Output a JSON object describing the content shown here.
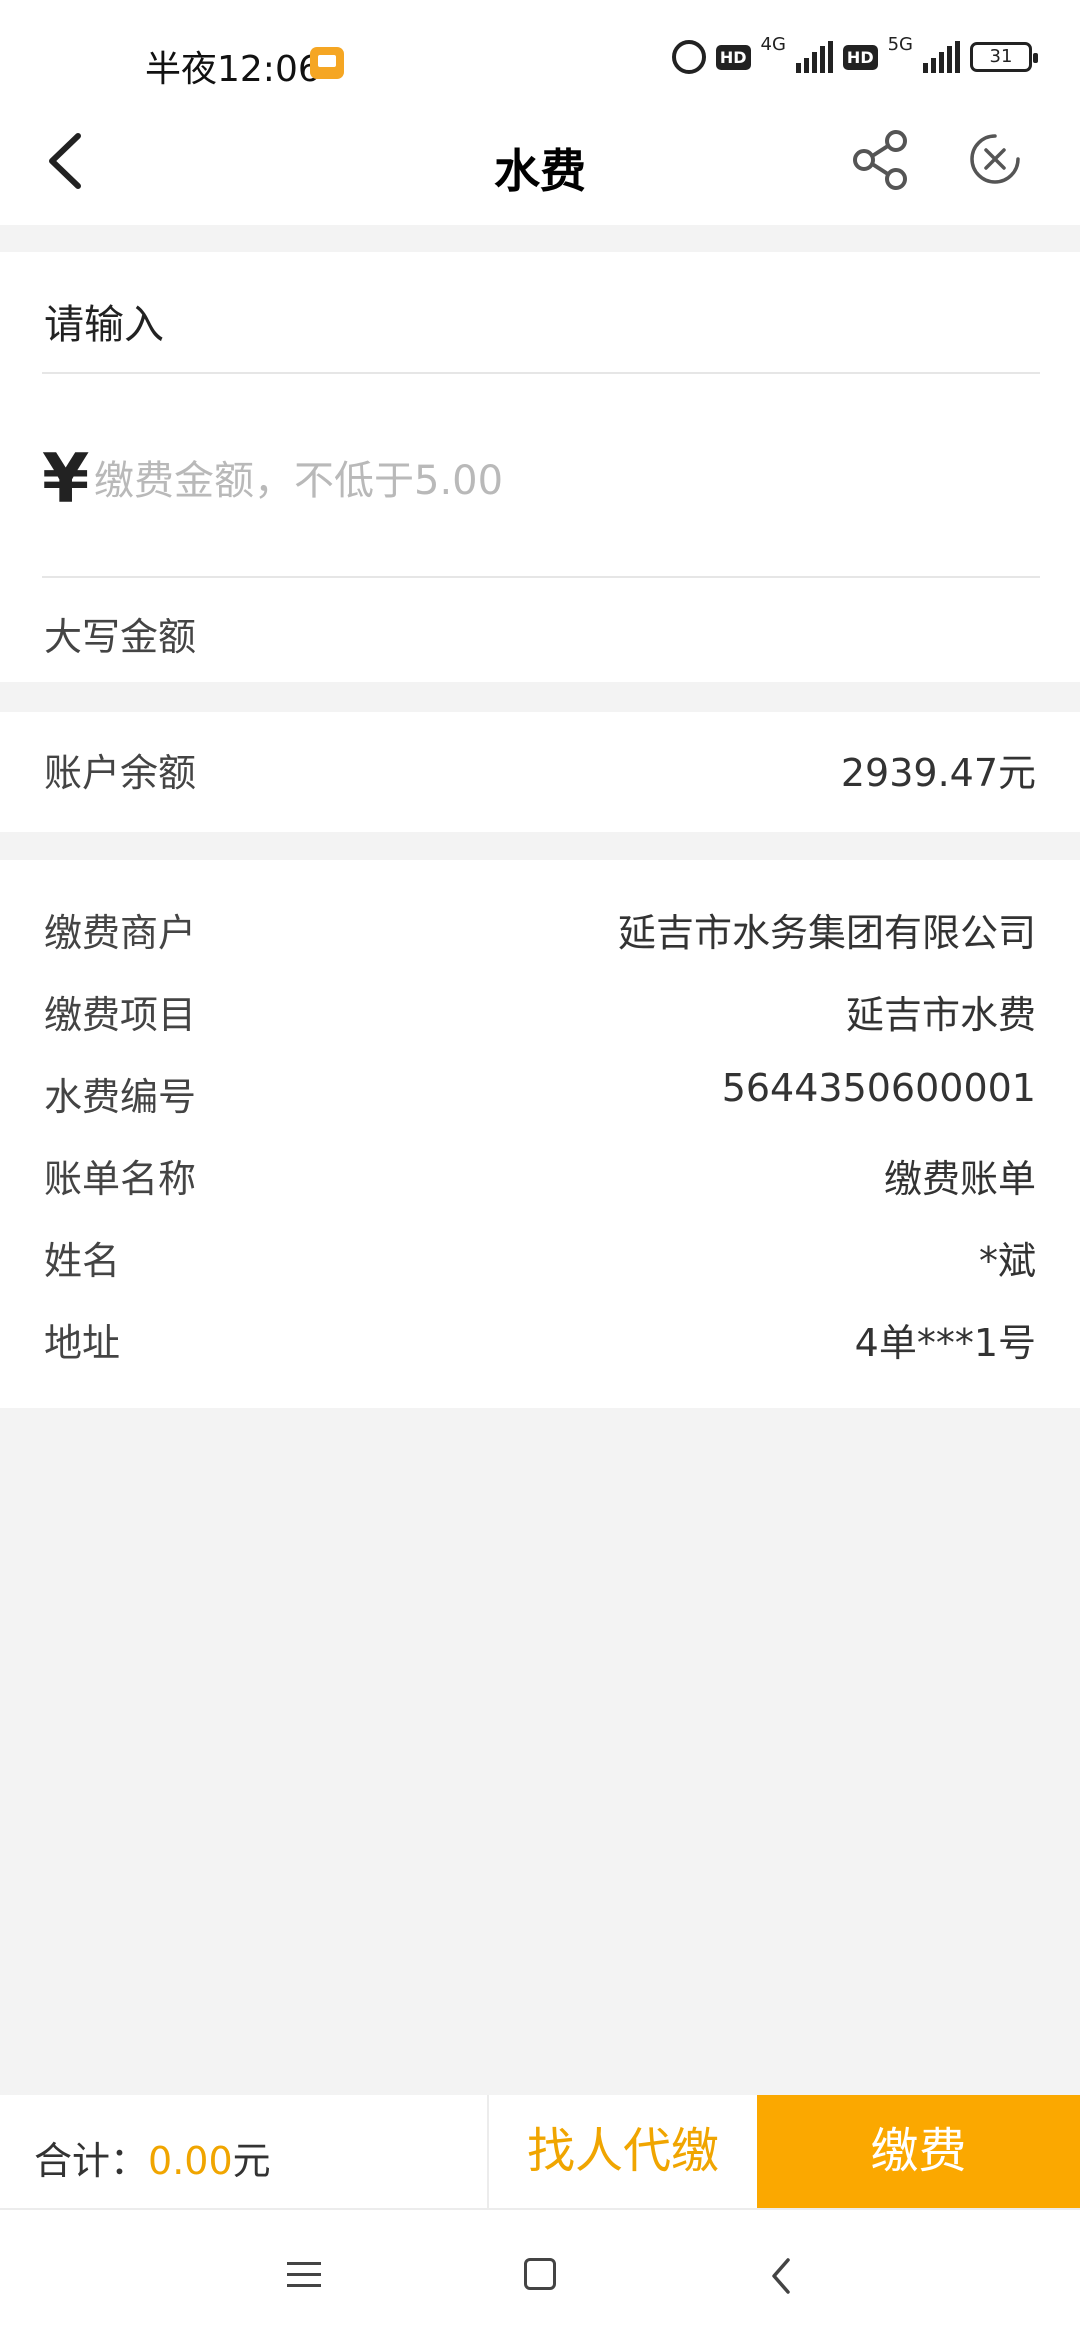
{
  "status_bar": {
    "time": "半夜12:06",
    "network_1": "4G",
    "network_2": "5G",
    "hd_label": "HD",
    "battery": "31",
    "icons": [
      "alarm-icon",
      "signal-icon",
      "battery-icon"
    ]
  },
  "header": {
    "title": "水费",
    "icons": [
      "back-arrow-icon",
      "share-icon",
      "close-circle-icon"
    ]
  },
  "payment_form": {
    "input_label": "请输入",
    "currency_symbol": "¥",
    "amount_placeholder": "缴费金额，不低于5.00",
    "amount_value": "",
    "capital_amount_label": "大写金额"
  },
  "balance": {
    "label": "账户余额",
    "value": "2939.47元"
  },
  "details": [
    {
      "label": "缴费商户",
      "value": "延吉市水务集团有限公司"
    },
    {
      "label": "缴费项目",
      "value": "延吉市水费"
    },
    {
      "label": "水费编号",
      "value": "5644350600001"
    },
    {
      "label": "账单名称",
      "value": "缴费账单"
    },
    {
      "label": "姓名",
      "value": "*斌"
    },
    {
      "label": "地址",
      "value": "4单***1号"
    }
  ],
  "footer": {
    "total_label": "合计：",
    "total_amount": "0.00",
    "total_unit": "元",
    "proxy_pay_label": "找人代缴",
    "pay_label": "缴费"
  },
  "colors": {
    "accent": "#fba800",
    "accent_text": "#f0a500",
    "background": "#f3f3f3"
  }
}
